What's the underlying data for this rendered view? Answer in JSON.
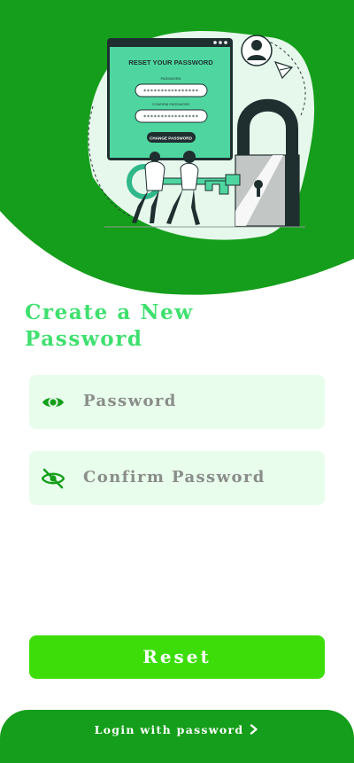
{
  "colors": {
    "brand_dark": "#159e1b",
    "brand_bright": "#3ddd0a",
    "title_green": "#3fe06e",
    "field_bg": "#e8fdec"
  },
  "illustration": {
    "card_title": "RESET YOUR PASSWORD",
    "password_label": "PASSWORD",
    "password_mask": "****************",
    "confirm_label": "CONFIRM PASSWORD",
    "confirm_mask": "****************",
    "button_label": "CHANGE PASSWORD"
  },
  "page": {
    "title_line1": "Create a New",
    "title_line2": "Password"
  },
  "fields": {
    "password": {
      "placeholder": "Password",
      "icon": "eye-icon"
    },
    "confirm": {
      "placeholder": "Confirm Password",
      "icon": "eye-off-icon"
    }
  },
  "actions": {
    "reset_label": "Reset",
    "login_label": "Login with password",
    "login_icon": "chevron-right-icon"
  }
}
